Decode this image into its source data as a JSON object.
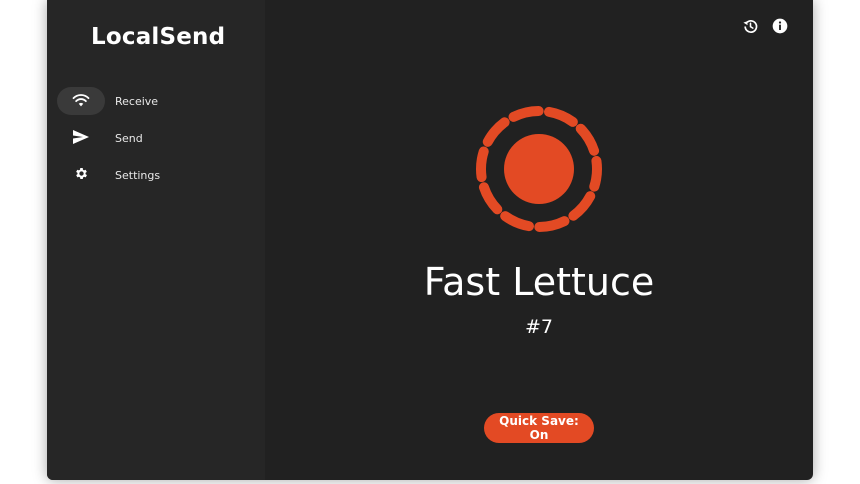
{
  "app": {
    "title": "LocalSend"
  },
  "sidebar": {
    "items": [
      {
        "label": "Receive",
        "icon": "wifi-icon",
        "active": true
      },
      {
        "label": "Send",
        "icon": "send-icon",
        "active": false
      },
      {
        "label": "Settings",
        "icon": "gear-icon",
        "active": false
      }
    ]
  },
  "header": {
    "icons": [
      "history-icon",
      "info-icon"
    ]
  },
  "main": {
    "device_name": "Fast Lettuce",
    "device_number": "#7",
    "quick_save_label": "Quick Save: On"
  },
  "colors": {
    "accent": "#e34a24",
    "background": "#212121",
    "sidebar": "#262626"
  }
}
